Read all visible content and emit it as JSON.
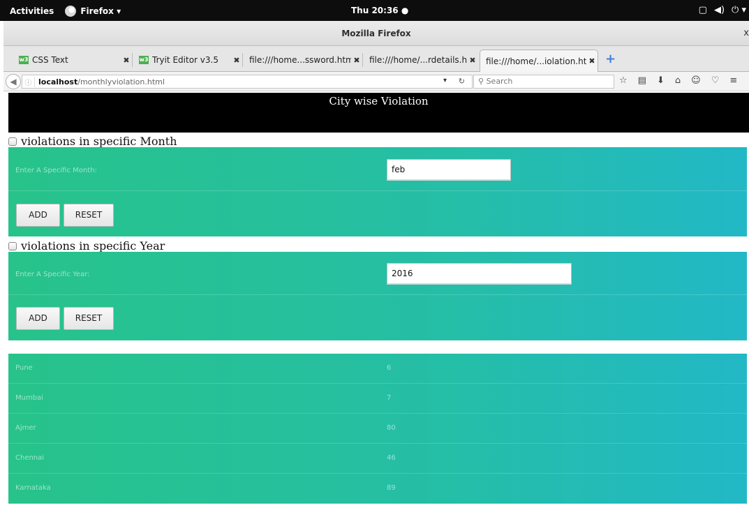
{
  "system": {
    "activities": "Activities",
    "app_menu": "Firefox ▾",
    "clock": "Thu 20:36 ●",
    "tray_icons": [
      "window-icon",
      "volume-icon",
      "power-icon"
    ]
  },
  "window": {
    "title": "Mozilla Firefox",
    "close_glyph": "x"
  },
  "tabs": [
    {
      "label": "CSS Text",
      "icon": "w3schools-icon",
      "active": false
    },
    {
      "label": "Tryit Editor v3.5",
      "icon": "w3schools-icon",
      "active": false
    },
    {
      "label": "file:///home...ssword.html",
      "icon": null,
      "active": false
    },
    {
      "label": "file:///home/...rdetails.html",
      "icon": null,
      "active": false
    },
    {
      "label": "file:///home/...iolation.html",
      "icon": null,
      "active": true
    }
  ],
  "navbar": {
    "url_host": "localhost",
    "url_path": "/monthlyviolation.html",
    "search_placeholder": "Search"
  },
  "page": {
    "header_title": "City wise Violation",
    "month_section": {
      "checkbox_label": "violations in specific Month",
      "field_label": "Enter A Specific Month:",
      "field_value": "feb",
      "add_label": "ADD",
      "reset_label": "RESET"
    },
    "year_section": {
      "checkbox_label": "violations in specific Year",
      "field_label": "Enter A Specific Year:",
      "field_value": "2016",
      "add_label": "ADD",
      "reset_label": "RESET"
    },
    "cities": [
      {
        "name": "Pune",
        "value": "6"
      },
      {
        "name": "Mumbai",
        "value": "7"
      },
      {
        "name": "Ajmer",
        "value": "80"
      },
      {
        "name": "Chennai",
        "value": "46"
      },
      {
        "name": "Karnataka",
        "value": "89"
      }
    ]
  },
  "colors": {
    "panel_start": "#27c38a",
    "panel_end": "#22b8c6",
    "header_bg": "#000000"
  }
}
